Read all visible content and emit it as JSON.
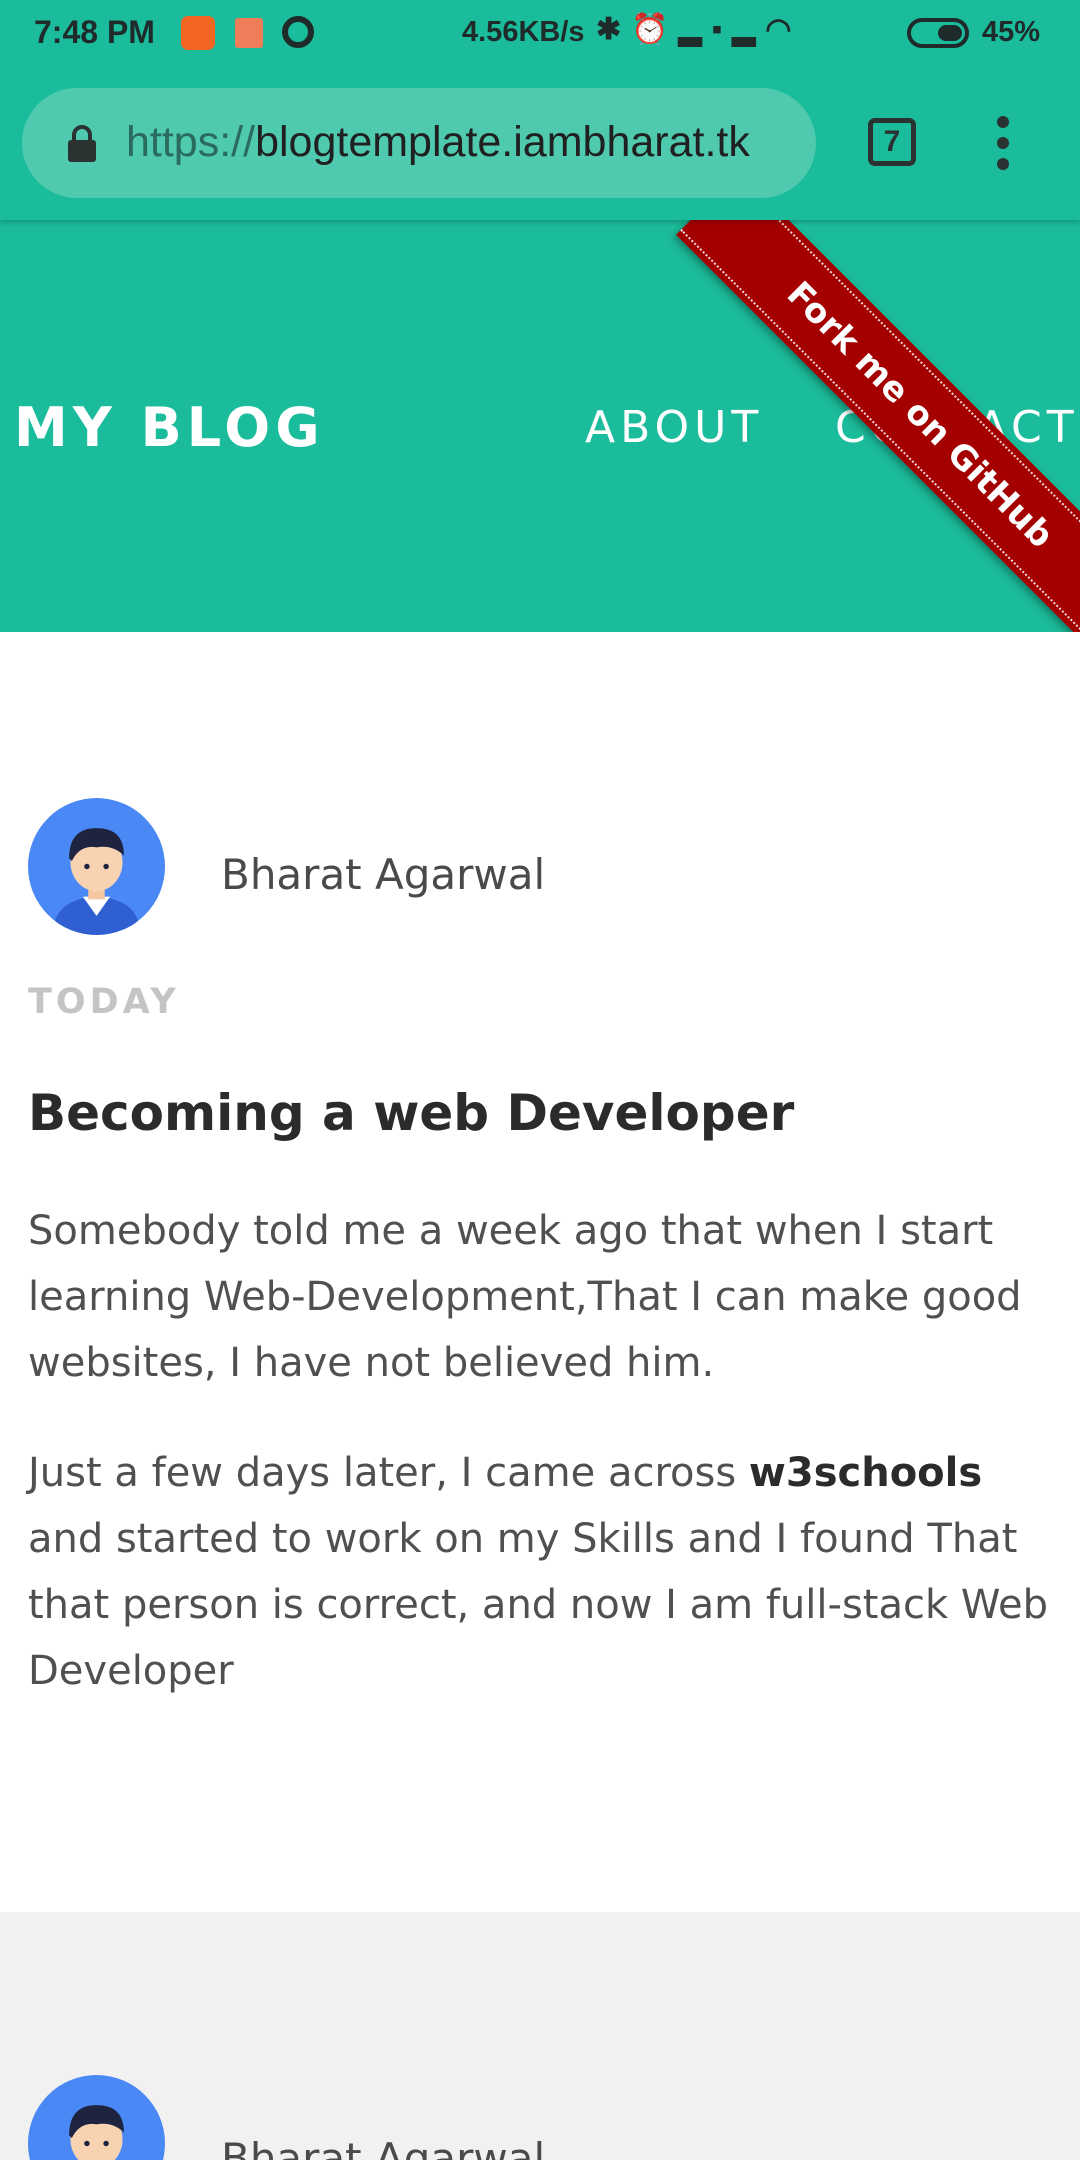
{
  "status_bar": {
    "time": "7:48 PM",
    "speed": "4.56KB/s",
    "battery": "45%",
    "icons": [
      "bluetooth-icon",
      "alarm-icon",
      "signal-icon",
      "volte-icon",
      "signal-icon",
      "wifi-icon",
      "battery-icon"
    ]
  },
  "browser": {
    "url_scheme": "https://",
    "url_host": "blogtemplate.iambharat.tk",
    "tab_count": "7"
  },
  "header": {
    "logo": "MY BLOG",
    "nav": [
      {
        "label": "ABOUT"
      },
      {
        "label": "CONTACT"
      }
    ],
    "ribbon": "Fork me on GitHub",
    "color": "#1bbc9b"
  },
  "posts": [
    {
      "author": "Bharat Agarwal",
      "date": "TODAY",
      "title": "Becoming a web Developer",
      "para1": "Somebody told me a week ago that when I start learning Web-Development,That I can make good websites, I have not believed him.",
      "para2_before": "Just a few days later, I came across ",
      "para2_bold": "w3schools",
      "para2_after": " and started to work on my Skills and I found That that person is correct, and now I am full-stack Web Developer"
    },
    {
      "author": "Bharat Agarwal"
    }
  ]
}
